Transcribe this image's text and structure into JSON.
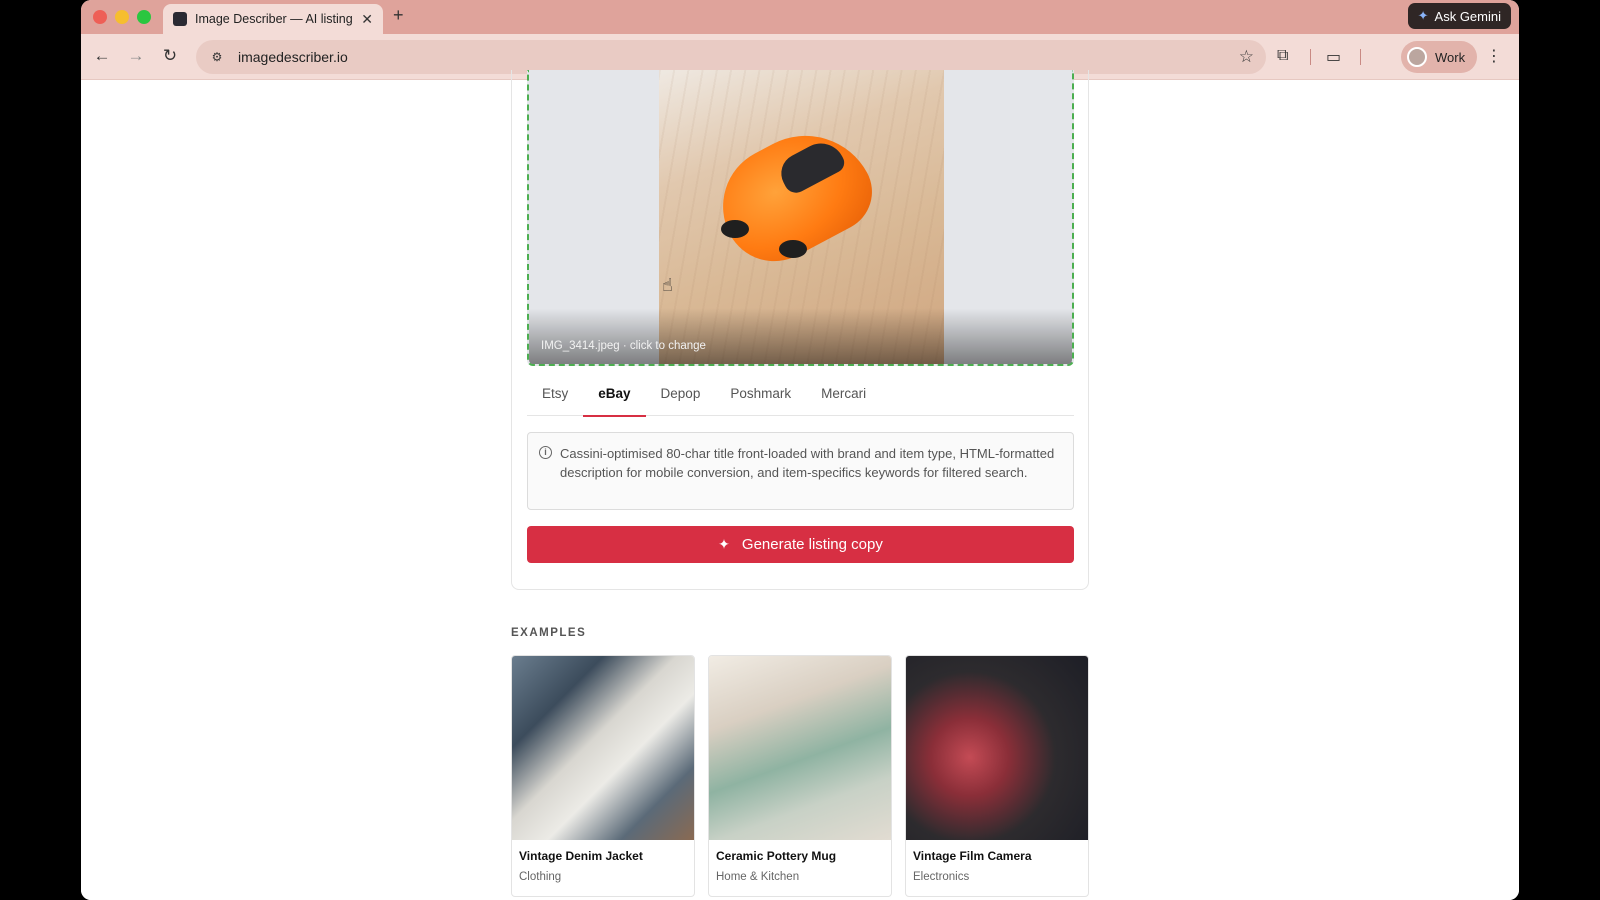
{
  "browser": {
    "tab_title": "Image Describer — AI listing c",
    "url": "imagedescriber.io",
    "ask_gemini_label": "Ask Gemini",
    "profile_label": "Work"
  },
  "upload": {
    "filename_caption": "IMG_3414.jpeg · click to change"
  },
  "platform_tabs": [
    {
      "label": "Etsy",
      "active": false
    },
    {
      "label": "eBay",
      "active": true
    },
    {
      "label": "Depop",
      "active": false
    },
    {
      "label": "Poshmark",
      "active": false
    },
    {
      "label": "Mercari",
      "active": false
    }
  ],
  "info_text": "Cassini-optimised 80-char title front-loaded with brand and item type, HTML-formatted description for mobile conversion, and item-specifics keywords for filtered search.",
  "generate_label": "Generate listing copy",
  "examples": {
    "title": "EXAMPLES",
    "items": [
      {
        "name": "Vintage Denim Jacket",
        "category": "Clothing"
      },
      {
        "name": "Ceramic Pottery Mug",
        "category": "Home & Kitchen"
      },
      {
        "name": "Vintage Film Camera",
        "category": "Electronics"
      }
    ]
  },
  "colors": {
    "accent": "#d72f43",
    "dropzone_border": "#4caf50"
  }
}
